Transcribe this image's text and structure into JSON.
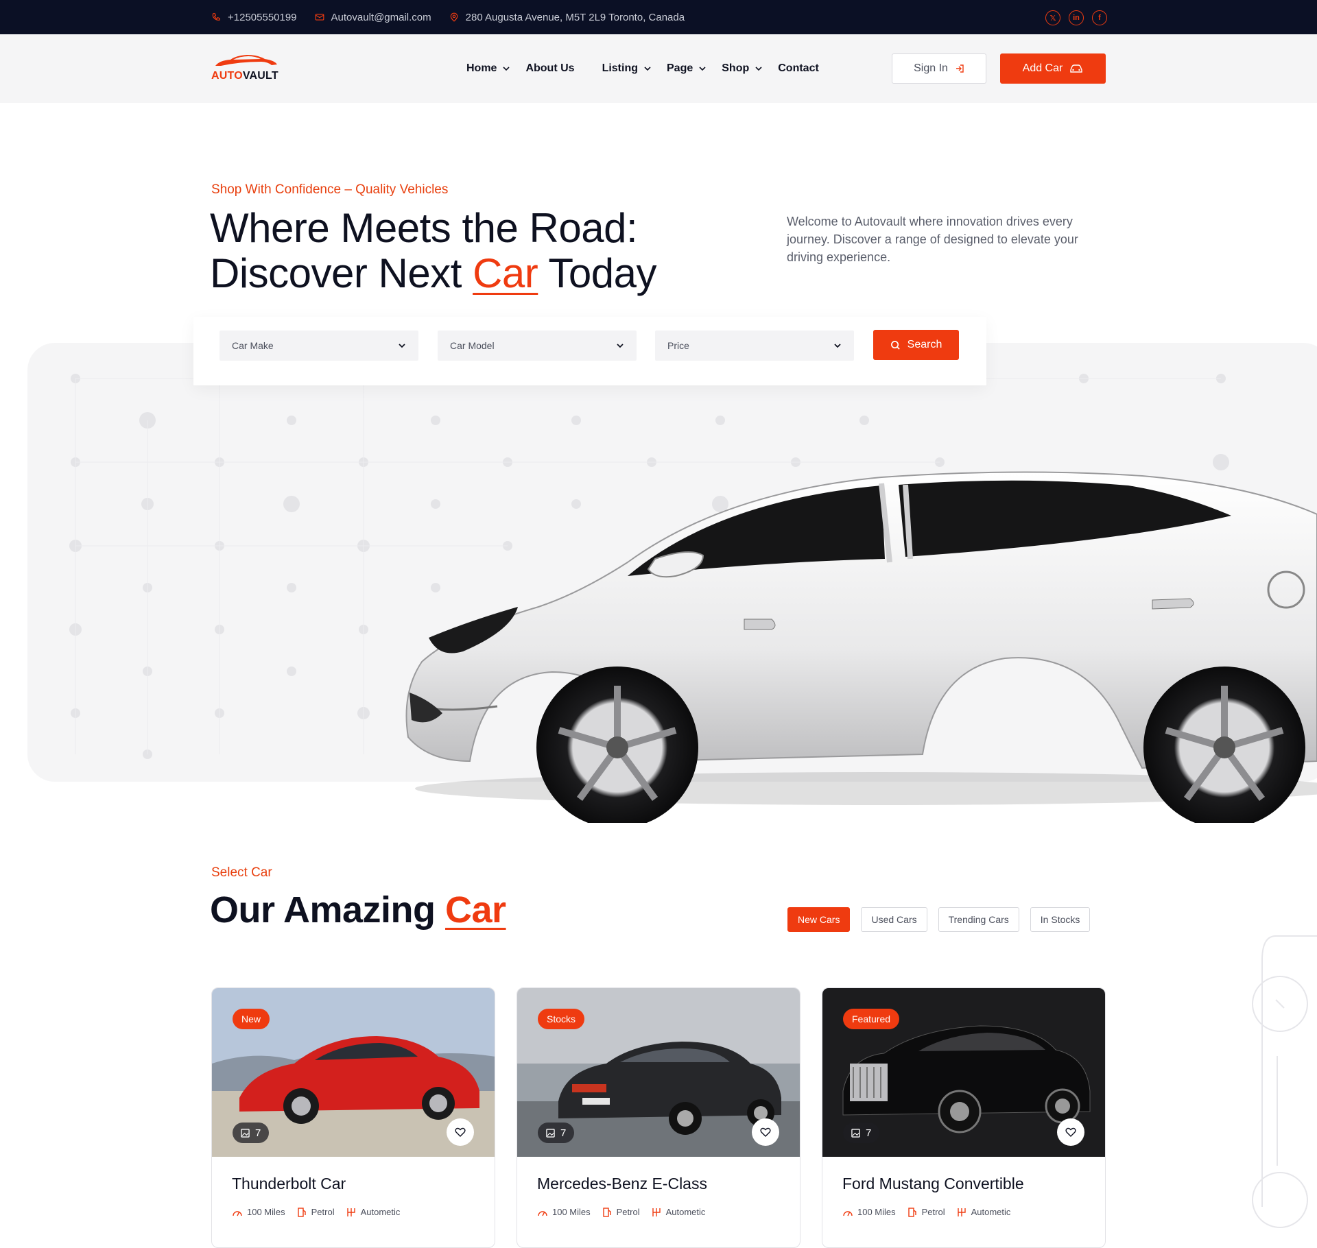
{
  "topbar": {
    "phone": "+12505550199",
    "email": "Autovault@gmail.com",
    "address": "280 Augusta Avenue, M5T 2L9 Toronto, Canada",
    "social": [
      {
        "icon": "x-icon",
        "label": "𝕏"
      },
      {
        "icon": "linkedin-icon",
        "label": "in"
      },
      {
        "icon": "facebook-icon",
        "label": "f"
      }
    ]
  },
  "header": {
    "logo_accent": "AUTO",
    "logo_rest": "VAULT",
    "nav": [
      {
        "label": "Home",
        "dropdown": true
      },
      {
        "label": "About Us",
        "dropdown": false
      },
      {
        "label": "Listing",
        "dropdown": true
      },
      {
        "label": "Page",
        "dropdown": true
      },
      {
        "label": "Shop",
        "dropdown": true
      },
      {
        "label": "Contact",
        "dropdown": false
      }
    ],
    "signin_label": "Sign In",
    "addcar_label": "Add Car"
  },
  "hero": {
    "subtitle": "Shop With Confidence – Quality Vehicles",
    "title_line1": "Where Meets the Road:",
    "title_line2_start": "Discover Next ",
    "title_highlight": "Car",
    "title_line2_end": " Today",
    "description": "Welcome to Autovault where innovation drives every journey. Discover a range of designed to elevate your driving experience."
  },
  "search": {
    "make_value": "Car Make",
    "model_value": "Car Model",
    "price_value": "Price",
    "button_label": "Search"
  },
  "select_section": {
    "subtitle": "Select Car",
    "title_start": "Our Amazing ",
    "title_highlight": "Car",
    "filters": [
      "New Cars",
      "Used Cars",
      "Trending Cars",
      "In Stocks"
    ],
    "active_filter": "New Cars"
  },
  "cars": [
    {
      "badge": "New",
      "photos": "7",
      "name": "Thunderbolt Car",
      "mileage": "100 Miles",
      "fuel": "Petrol",
      "transmission": "Autometic"
    },
    {
      "badge": "Stocks",
      "photos": "7",
      "name": "Mercedes-Benz E-Class",
      "mileage": "100 Miles",
      "fuel": "Petrol",
      "transmission": "Autometic"
    },
    {
      "badge": "Featured",
      "photos": "7",
      "name": "Ford Mustang Convertible",
      "mileage": "100 Miles",
      "fuel": "Petrol",
      "transmission": "Autometic"
    }
  ],
  "colors": {
    "accent": "#ef3b10",
    "dark": "#0b1025",
    "text": "#0e1120"
  }
}
